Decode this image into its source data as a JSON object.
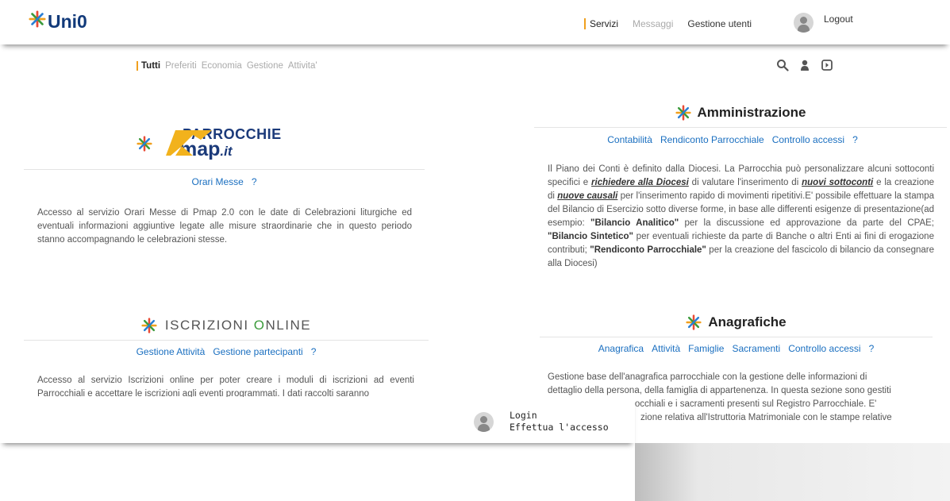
{
  "app": {
    "logo_text": "Uni0",
    "brand_color": "#123a7a",
    "accent_color": "#f0a01e"
  },
  "topnav": {
    "items": [
      "Servizi",
      "Messaggi",
      "Gestione utenti"
    ],
    "logout": "Logout"
  },
  "subnav": {
    "items": [
      "Tutti",
      "Preferiti",
      "Economia",
      "Gestione",
      "Attivita'"
    ],
    "icons": [
      "search-icon",
      "user-icon",
      "exit-icon"
    ]
  },
  "pmap": {
    "logo_line1": "PARROCCHIE",
    "logo_line2": "map",
    "logo_suffix": ".it",
    "links": [
      "Orari Messe",
      "?"
    ],
    "desc": "Accesso al servizio Orari Messe di Pmap 2.0 con le date di Celebrazioni liturgiche ed eventuali informazioni aggiuntive legate alle misure straordinarie che in questo periodo stanno accompagnando le celebrazioni stesse."
  },
  "amministrazione": {
    "title": "Amministrazione",
    "links": [
      "Contabilità",
      "Rendiconto Parrocchiale",
      "Controllo accessi",
      "?"
    ],
    "desc_p1": "Il Piano dei Conti è definito dalla Diocesi. La Parrocchia può personalizzare alcuni sottoconti specifici e ",
    "desc_em1": "richiedere alla Diocesi",
    "desc_p2": " di valutare l'inserimento di ",
    "desc_em2": "nuovi sottoconti",
    "desc_p3": " e la creazione di ",
    "desc_em3": "nuove causali",
    "desc_p4": " per l'inserimento rapido di movimenti ripetitivi.E' possibile effettuare la stampa del Bilancio di Esercizio sotto diverse forme, in base alle differenti esigenze di presentazione(ad esempio: ",
    "desc_b1": "\"Bilancio Analitico\"",
    "desc_p5": " per la discussione ed approvazione da parte del CPAE; ",
    "desc_b2": "\"Bilancio Sintetico\"",
    "desc_p6": " per eventuali richieste da parte di Banche o altri Enti ai fini di erogazione contributi; ",
    "desc_b3": "\"Rendiconto Parrocchiale\"",
    "desc_p7": " per la creazione del fascicolo di bilancio da consegnare alla Diocesi)"
  },
  "iscrizioni": {
    "title_a": "ISCRIZIONI ",
    "title_b": "O",
    "title_c": "NLINE",
    "links": [
      "Gestione Attività",
      "Gestione partecipanti",
      "?"
    ],
    "desc": "Accesso al servizio Iscrizioni online per poter creare i moduli di iscrizioni ad eventi Parrocchiali e accettare le iscrizioni agli eventi programmati. I dati raccolti saranno"
  },
  "anagrafiche": {
    "title": "Anagrafiche",
    "links": [
      "Anagrafica",
      "Attività",
      "Famiglie",
      "Sacramenti",
      "Controllo accessi",
      "?"
    ],
    "desc_line1": "Gestione base dell'anagrafica parrocchiale con la gestione delle informazioni di",
    "desc_line2": "dettaglio della persona, della famiglia di appartenenza. In questa sezione sono gestiti",
    "desc_line3": "rocchiali e i sacramenti presenti sul Registro Parrocchiale. E'",
    "desc_line4": "zione relativa all'Istruttoria Matrimoniale con le stampe relative"
  },
  "login": {
    "line1": "Login",
    "line2": "Effettua l'accesso"
  }
}
